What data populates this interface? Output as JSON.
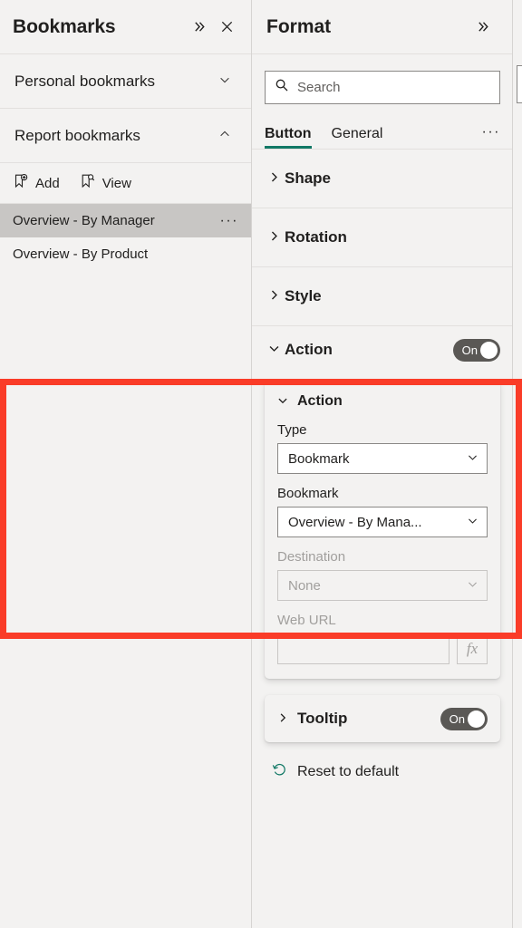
{
  "bookmarks_pane": {
    "title": "Bookmarks",
    "expand_icon": "double-chevron-right-icon",
    "close_icon": "close-icon",
    "sections": [
      {
        "label": "Personal bookmarks",
        "chevron": "chevron-down-icon",
        "expanded": false
      },
      {
        "label": "Report bookmarks",
        "chevron": "chevron-up-icon",
        "expanded": true
      }
    ],
    "actions": [
      {
        "label": "Add",
        "icon": "bookmark-add-icon"
      },
      {
        "label": "View",
        "icon": "bookmark-view-icon"
      }
    ],
    "items": [
      {
        "label": "Overview - By Manager",
        "selected": true,
        "more_icon": "ellipsis-icon"
      },
      {
        "label": "Overview - By Product",
        "selected": false
      }
    ]
  },
  "format_pane": {
    "title": "Format",
    "expand_icon": "double-chevron-right-icon",
    "search": {
      "placeholder": "Search",
      "value": "",
      "icon": "search-icon"
    },
    "tabs": [
      {
        "label": "Button",
        "active": true
      },
      {
        "label": "General",
        "active": false
      }
    ],
    "tabs_more": "···",
    "accordions": [
      {
        "label": "Shape",
        "chevron": "chevron-right-icon",
        "expanded": false
      },
      {
        "label": "Rotation",
        "chevron": "chevron-right-icon",
        "expanded": false
      },
      {
        "label": "Style",
        "chevron": "chevron-right-icon",
        "expanded": false
      }
    ],
    "action_section": {
      "label": "Action",
      "chevron": "chevron-down-icon",
      "toggle": {
        "label": "On",
        "state": "on"
      },
      "card": {
        "label": "Action",
        "chevron": "chevron-down-icon",
        "type_field": {
          "label": "Type",
          "value": "Bookmark",
          "chevron": "chevron-down-icon",
          "disabled": false
        },
        "bookmark_field": {
          "label": "Bookmark",
          "value": "Overview - By Mana...",
          "chevron": "chevron-down-icon",
          "disabled": false
        },
        "destination_field": {
          "label": "Destination",
          "value": "None",
          "chevron": "chevron-down-icon",
          "disabled": true
        },
        "weburl_field": {
          "label": "Web URL",
          "value": "",
          "fx_label": "fx",
          "disabled": true
        }
      }
    },
    "tooltip_section": {
      "label": "Tooltip",
      "chevron": "chevron-right-icon",
      "toggle": {
        "label": "On",
        "state": "on"
      }
    },
    "reset": {
      "label": "Reset to default",
      "icon": "undo-icon"
    }
  },
  "highlight": {
    "color": "#fa3c28",
    "target": "action-section"
  }
}
